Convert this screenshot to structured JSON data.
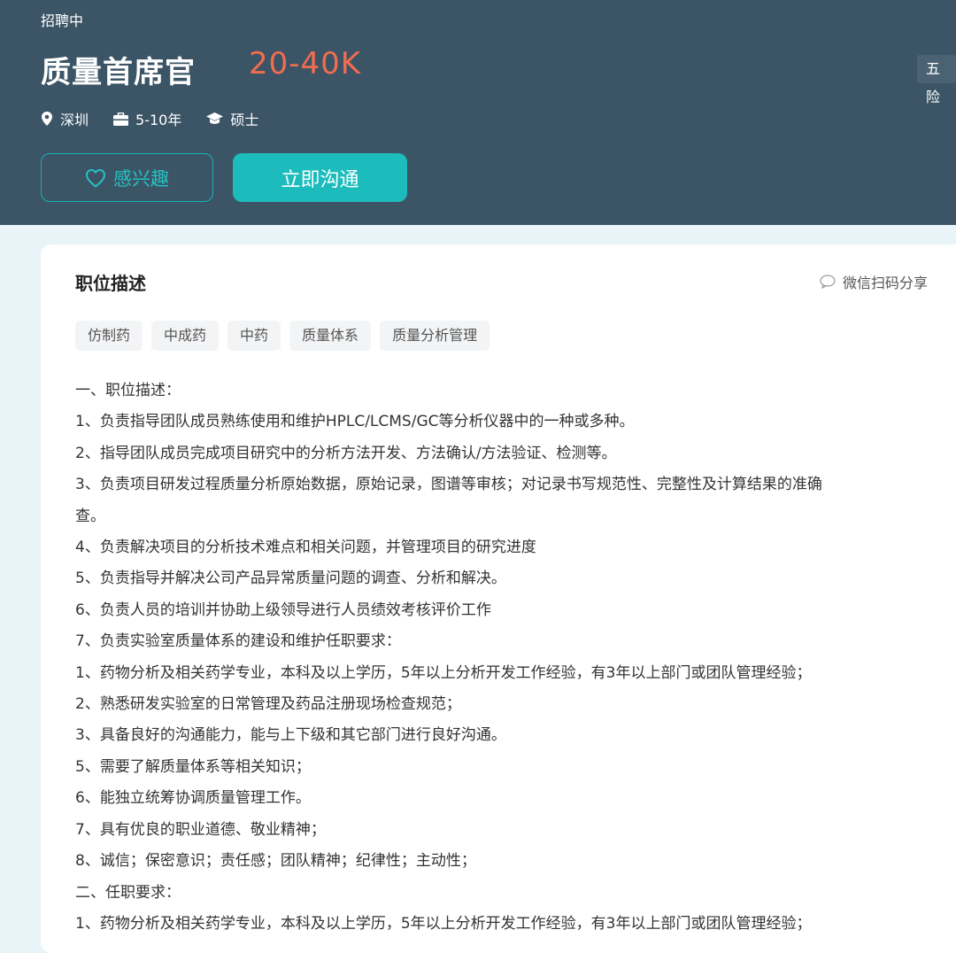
{
  "header": {
    "status": "招聘中",
    "title": "质量首席官",
    "salary": "20-40K",
    "welfare_tag": "五险",
    "meta": {
      "location": "深圳",
      "experience": "5-10年",
      "education": "硕士"
    },
    "interest_button": "感兴趣",
    "chat_button": "立即沟通"
  },
  "colors": {
    "header_bg": "#3b5466",
    "salary": "#f26d4f",
    "accent": "#1cbcbc"
  },
  "section": {
    "title": "职位描述",
    "share": "微信扫码分享",
    "tags": [
      "仿制药",
      "中成药",
      "中药",
      "质量体系",
      "质量分析管理"
    ],
    "lines": [
      "一、职位描述：",
      "1、负责指导团队成员熟练使用和维护HPLC/LCMS/GC等分析仪器中的一种或多种。",
      "2、指导团队成员完成项目研究中的分析方法开发、方法确认/方法验证、检测等。",
      "3、负责项目研发过程质量分析原始数据，原始记录，图谱等审核；对记录书写规范性、完整性及计算结果的准确",
      "查。",
      "4、负责解决项目的分析技术难点和相关问题，并管理项目的研究进度",
      "5、负责指导并解决公司产品异常质量问题的调查、分析和解决。",
      "6、负责人员的培训并协助上级领导进行人员绩效考核评价工作",
      "7、负责实验室质量体系的建设和维护任职要求：",
      "1、药物分析及相关药学专业，本科及以上学历，5年以上分析开发工作经验，有3年以上部门或团队管理经验；",
      "2、熟悉研发实验室的日常管理及药品注册现场检查规范；",
      "3、具备良好的沟通能力，能与上下级和其它部门进行良好沟通。",
      "5、需要了解质量体系等相关知识；",
      "6、能独立统筹协调质量管理工作。",
      "7、具有优良的职业道德、敬业精神；",
      "8、诚信；保密意识；责任感；团队精神；纪律性；主动性；",
      "二、任职要求：",
      "1、药物分析及相关药学专业，本科及以上学历，5年以上分析开发工作经验，有3年以上部门或团队管理经验；"
    ]
  }
}
